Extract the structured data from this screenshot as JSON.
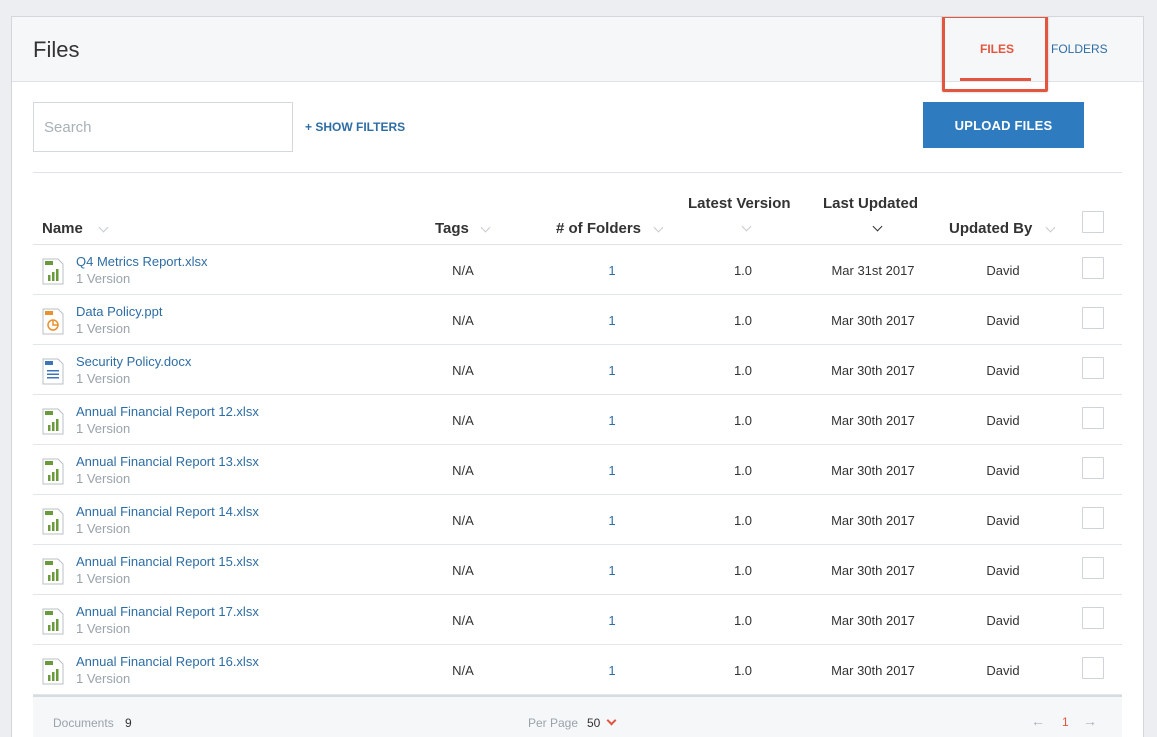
{
  "header": {
    "title": "Files",
    "tabs": [
      {
        "label": "FILES",
        "active": true
      },
      {
        "label": "FOLDERS",
        "active": false
      }
    ]
  },
  "toolbar": {
    "search_placeholder": "Search",
    "search_value": "",
    "show_filters_label": "+ SHOW FILTERS",
    "upload_label": "UPLOAD FILES"
  },
  "table": {
    "columns": {
      "name": "Name",
      "tags": "Tags",
      "folders": "# of Folders",
      "latest_version": "Latest Version",
      "last_updated": "Last Updated",
      "updated_by": "Updated By"
    },
    "rows": [
      {
        "name": "Q4 Metrics Report.xlsx",
        "versions": "1 Version",
        "type": "xlsx",
        "tags": "N/A",
        "folders": "1",
        "latest_version": "1.0",
        "last_updated": "Mar 31st 2017",
        "updated_by": "David"
      },
      {
        "name": "Data Policy.ppt",
        "versions": "1 Version",
        "type": "ppt",
        "tags": "N/A",
        "folders": "1",
        "latest_version": "1.0",
        "last_updated": "Mar 30th 2017",
        "updated_by": "David"
      },
      {
        "name": "Security Policy.docx",
        "versions": "1 Version",
        "type": "docx",
        "tags": "N/A",
        "folders": "1",
        "latest_version": "1.0",
        "last_updated": "Mar 30th 2017",
        "updated_by": "David"
      },
      {
        "name": "Annual Financial Report 12.xlsx",
        "versions": "1 Version",
        "type": "xlsx",
        "tags": "N/A",
        "folders": "1",
        "latest_version": "1.0",
        "last_updated": "Mar 30th 2017",
        "updated_by": "David"
      },
      {
        "name": "Annual Financial Report 13.xlsx",
        "versions": "1 Version",
        "type": "xlsx",
        "tags": "N/A",
        "folders": "1",
        "latest_version": "1.0",
        "last_updated": "Mar 30th 2017",
        "updated_by": "David"
      },
      {
        "name": "Annual Financial Report 14.xlsx",
        "versions": "1 Version",
        "type": "xlsx",
        "tags": "N/A",
        "folders": "1",
        "latest_version": "1.0",
        "last_updated": "Mar 30th 2017",
        "updated_by": "David"
      },
      {
        "name": "Annual Financial Report 15.xlsx",
        "versions": "1 Version",
        "type": "xlsx",
        "tags": "N/A",
        "folders": "1",
        "latest_version": "1.0",
        "last_updated": "Mar 30th 2017",
        "updated_by": "David"
      },
      {
        "name": "Annual Financial Report 17.xlsx",
        "versions": "1 Version",
        "type": "xlsx",
        "tags": "N/A",
        "folders": "1",
        "latest_version": "1.0",
        "last_updated": "Mar 30th 2017",
        "updated_by": "David"
      },
      {
        "name": "Annual Financial Report 16.xlsx",
        "versions": "1 Version",
        "type": "xlsx",
        "tags": "N/A",
        "folders": "1",
        "latest_version": "1.0",
        "last_updated": "Mar 30th 2017",
        "updated_by": "David"
      }
    ]
  },
  "footer": {
    "documents_label": "Documents",
    "documents_count": "9",
    "per_page_label": "Per Page",
    "per_page_value": "50",
    "current_page": "1",
    "prev_arrow": "←",
    "next_arrow": "→"
  },
  "colors": {
    "accent": "#e2553f",
    "link": "#2e6da4",
    "primary_button": "#2f7bbf",
    "xlsx_icon": "#6a9a3c",
    "ppt_icon": "#e8912e",
    "docx_icon": "#3c74b8"
  },
  "icons": {
    "xlsx": "spreadsheet-file-icon",
    "ppt": "presentation-file-icon",
    "docx": "document-file-icon"
  }
}
